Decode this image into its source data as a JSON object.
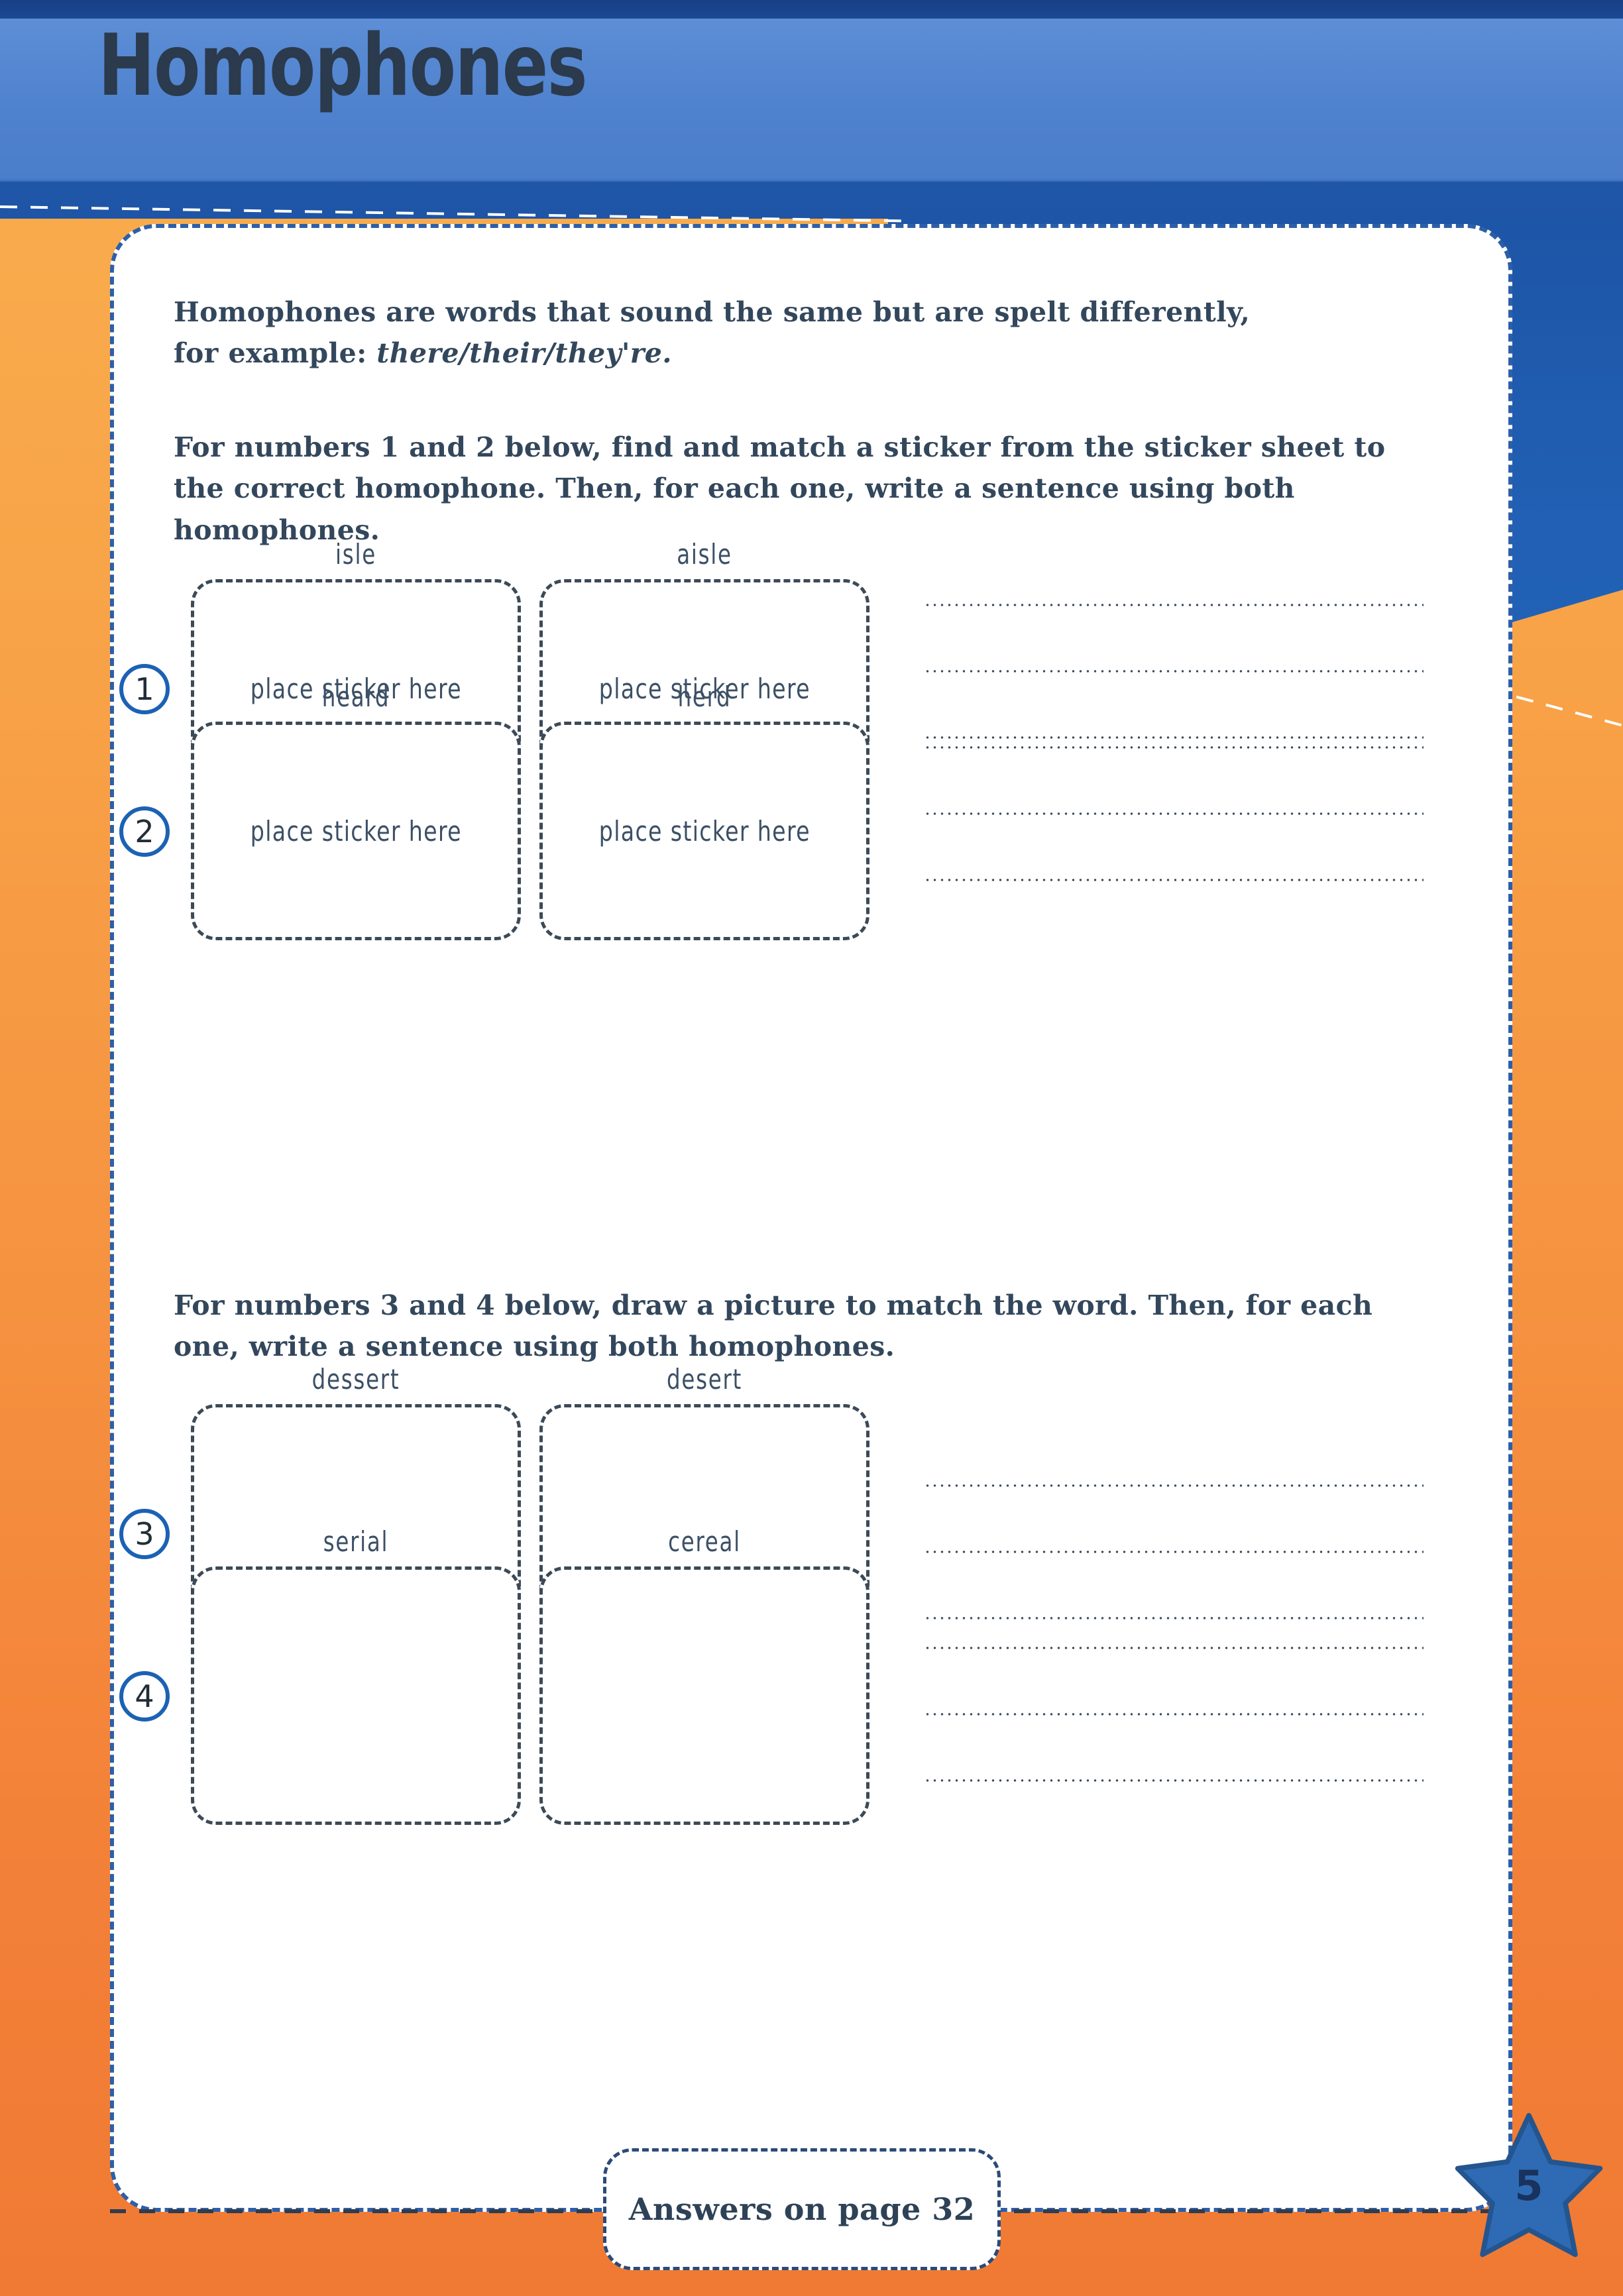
{
  "page": {
    "title": "Homophones",
    "page_number": "5",
    "answers_note": "Answers on page 32"
  },
  "colors": {
    "title_band": "#5183CE",
    "deep_blue": "#1F56A8",
    "orange_top": "#F9AB4C",
    "orange_bottom": "#F07A33",
    "ink": "#33475C",
    "circle_blue": "#1B62B4",
    "star_blue": "#2E6BB4"
  },
  "intro": {
    "line1": "Homophones are words that sound the same but are spelt differently,",
    "line2_lead": "for example: ",
    "line2_example": "there/their/they're."
  },
  "instructions": {
    "task1": "For numbers 1 and 2 below, find and match a sticker from the sticker sheet to the correct homophone. Then, for each one, write a sentence using both homophones.",
    "task2": "For numbers 3 and 4 below, draw a picture to match the word. Then, for each one, write a sentence using both homophones."
  },
  "placeholder_text": "place sticker here",
  "exercises": [
    {
      "number": "1",
      "kind": "sticker",
      "word_left": "isle",
      "word_right": "aisle",
      "box_left_text": "place sticker here",
      "box_right_text": "place sticker here",
      "answer_lines": 3
    },
    {
      "number": "2",
      "kind": "sticker",
      "word_left": "heard",
      "word_right": "herd",
      "box_left_text": "place sticker here",
      "box_right_text": "place sticker here",
      "answer_lines": 3
    },
    {
      "number": "3",
      "kind": "drawing",
      "word_left": "dessert",
      "word_right": "desert",
      "box_left_text": "",
      "box_right_text": "",
      "answer_lines": 3
    },
    {
      "number": "4",
      "kind": "drawing",
      "word_left": "serial",
      "word_right": "cereal",
      "box_left_text": "",
      "box_right_text": "",
      "answer_lines": 3
    }
  ]
}
